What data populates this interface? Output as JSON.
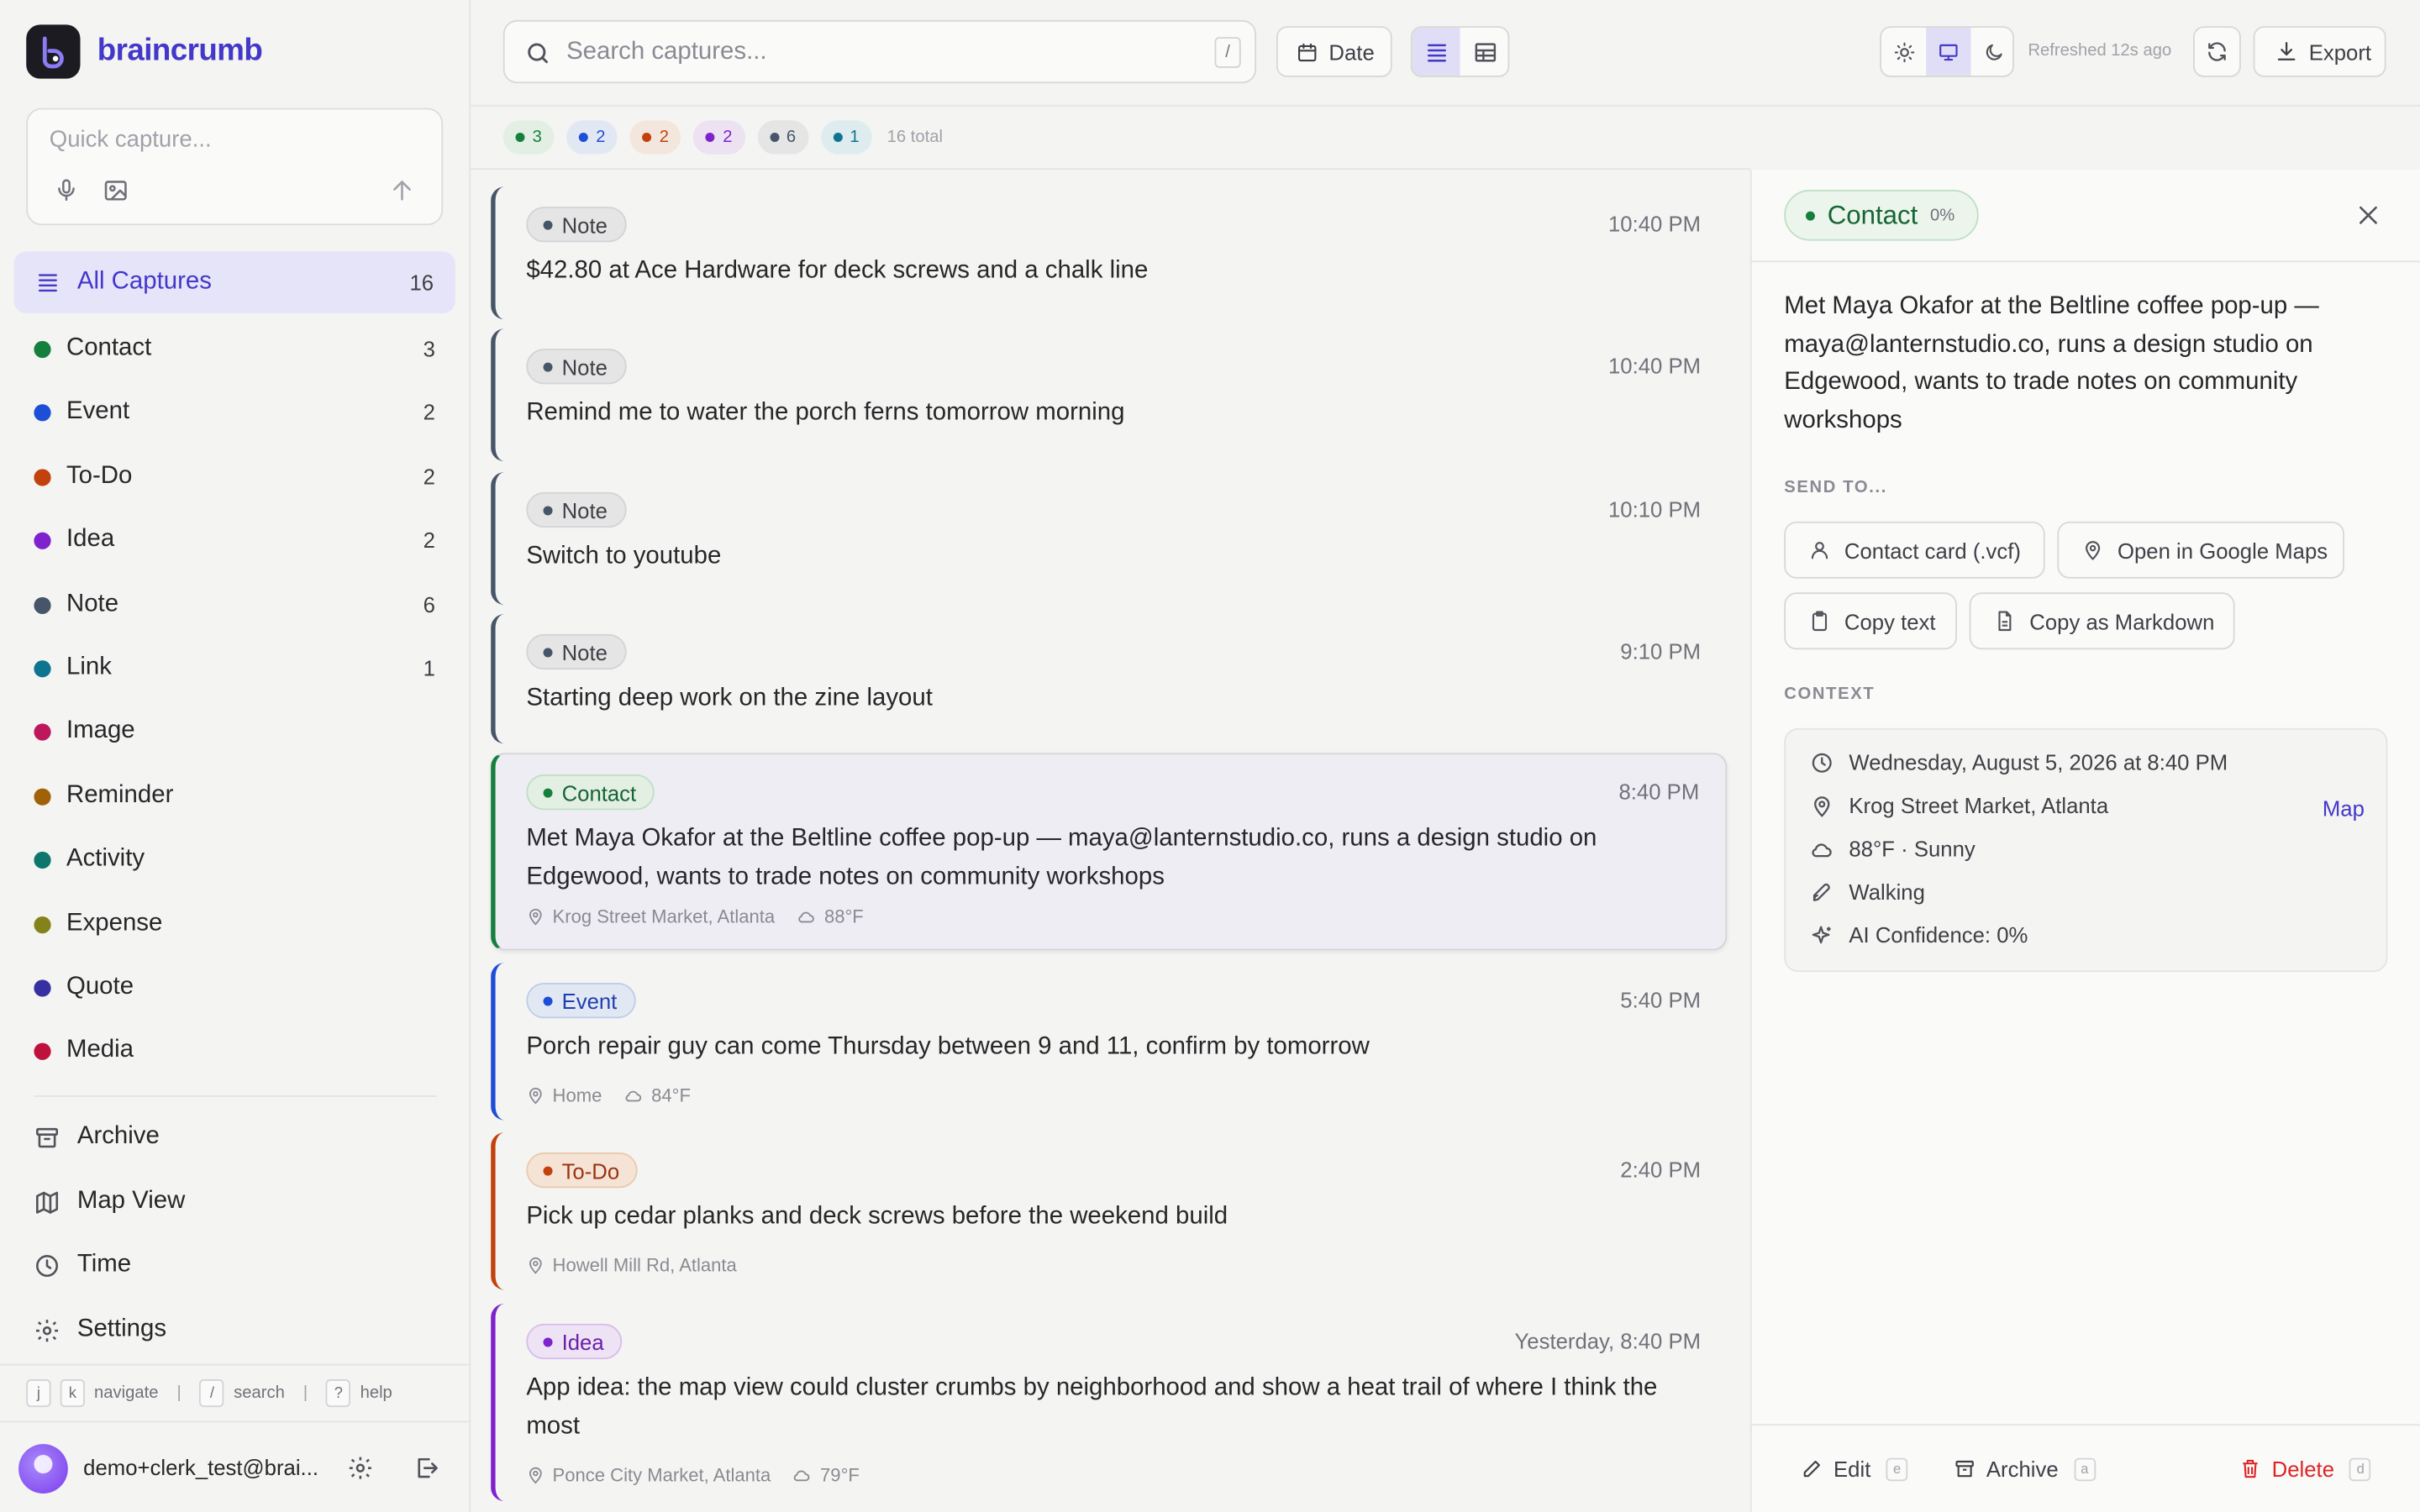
{
  "app": {
    "name": "braincrumb"
  },
  "quick_capture": {
    "placeholder": "Quick capture..."
  },
  "sidebar": {
    "all": {
      "label": "All Captures",
      "count": "16"
    },
    "categories": [
      {
        "label": "Contact",
        "count": "3",
        "color": "#15803d"
      },
      {
        "label": "Event",
        "count": "2",
        "color": "#1d4ed8"
      },
      {
        "label": "To-Do",
        "count": "2",
        "color": "#c2410c"
      },
      {
        "label": "Idea",
        "count": "2",
        "color": "#7e22ce"
      },
      {
        "label": "Note",
        "count": "6",
        "color": "#475569"
      },
      {
        "label": "Link",
        "count": "1",
        "color": "#0e7490"
      },
      {
        "label": "Image",
        "count": "",
        "color": "#be185d"
      },
      {
        "label": "Reminder",
        "count": "",
        "color": "#a16207"
      },
      {
        "label": "Activity",
        "count": "",
        "color": "#0f766e"
      },
      {
        "label": "Expense",
        "count": "",
        "color": "#84821a"
      },
      {
        "label": "Quote",
        "count": "",
        "color": "#3730a3"
      },
      {
        "label": "Media",
        "count": "",
        "color": "#be123c"
      }
    ],
    "secondary": [
      {
        "label": "Archive",
        "icon": "archive-icon"
      },
      {
        "label": "Map View",
        "icon": "map-icon"
      },
      {
        "label": "Time",
        "icon": "clock-icon"
      },
      {
        "label": "Settings",
        "icon": "gear-icon"
      }
    ],
    "shortcuts": {
      "j": "j",
      "k": "k",
      "navigate": "navigate",
      "slash": "/",
      "search": "search",
      "q": "?",
      "help": "help"
    },
    "user_email": "demo+clerk_test@brai..."
  },
  "topbar": {
    "search_placeholder": "Search captures...",
    "search_shortcut": "/",
    "date_label": "Date",
    "refreshed": "Refreshed 12s ago",
    "export_label": "Export"
  },
  "filters": {
    "chips": [
      {
        "count": "3",
        "color": "#15803d",
        "bg": "#e3efe3"
      },
      {
        "count": "2",
        "color": "#1d4ed8",
        "bg": "#e2e8f3"
      },
      {
        "count": "2",
        "color": "#c2410c",
        "bg": "#f3e6dc"
      },
      {
        "count": "2",
        "color": "#7e22ce",
        "bg": "#ece2f2"
      },
      {
        "count": "6",
        "color": "#475569",
        "bg": "#e5e5e5"
      },
      {
        "count": "1",
        "color": "#0e7490",
        "bg": "#dfecef"
      }
    ],
    "total": "16 total"
  },
  "captures": [
    {
      "type": "Note",
      "time": "10:40 PM",
      "text": "$42.80 at Ace Hardware for deck screws and a chalk line",
      "location": "",
      "weather": ""
    },
    {
      "type": "Note",
      "time": "10:40 PM",
      "text": "Remind me to water the porch ferns tomorrow morning",
      "location": "",
      "weather": ""
    },
    {
      "type": "Note",
      "time": "10:10 PM",
      "text": "Switch to youtube",
      "location": "",
      "weather": ""
    },
    {
      "type": "Note",
      "time": "9:10 PM",
      "text": "Starting deep work on the zine layout",
      "location": "",
      "weather": ""
    },
    {
      "type": "Contact",
      "time": "8:40 PM",
      "text": "Met Maya Okafor at the Beltline coffee pop-up — maya@lanternstudio.co, runs a design studio on Edgewood, wants to trade notes on community workshops",
      "location": "Krog Street Market, Atlanta",
      "weather": "88°F"
    },
    {
      "type": "Event",
      "time": "5:40 PM",
      "text": "Porch repair guy can come Thursday between 9 and 11, confirm by tomorrow",
      "location": "Home",
      "weather": "84°F"
    },
    {
      "type": "To-Do",
      "time": "2:40 PM",
      "text": "Pick up cedar planks and deck screws before the weekend build",
      "location": "Howell Mill Rd, Atlanta",
      "weather": ""
    },
    {
      "type": "Idea",
      "time": "Yesterday, 8:40 PM",
      "text": "App idea: the map view could cluster crumbs by neighborhood and show a heat trail of where I think the most",
      "location": "Ponce City Market, Atlanta",
      "weather": "79°F"
    }
  ],
  "detail": {
    "type": "Contact",
    "confidence": "0%",
    "text": "Met Maya Okafor at the Beltline coffee pop-up — maya@lanternstudio.co, runs a design studio on Edgewood, wants to trade notes on community workshops",
    "send_to_label": "SEND TO...",
    "actions": [
      "Contact card (.vcf)",
      "Open in Google Maps",
      "Copy text",
      "Copy as Markdown"
    ],
    "context_label": "CONTEXT",
    "context": {
      "datetime": "Wednesday, August 5, 2026 at 8:40 PM",
      "location": "Krog Street Market, Atlanta",
      "map_link": "Map",
      "weather": "88°F · Sunny",
      "activity": "Walking",
      "ai_confidence": "AI Confidence: 0%"
    },
    "footer": {
      "edit": "Edit",
      "edit_key": "e",
      "archive": "Archive",
      "archive_key": "a",
      "delete": "Delete",
      "delete_key": "d"
    }
  }
}
